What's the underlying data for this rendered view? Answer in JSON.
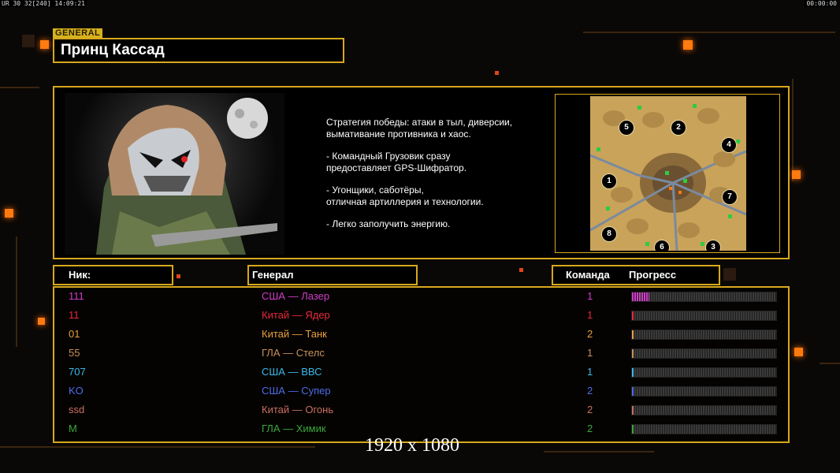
{
  "status_bar": {
    "left": "UR 30 32[240] 14:09:21",
    "right": "00:00:00"
  },
  "general_tag": "GENERAL",
  "general_name": "Принц Кассад",
  "strategy": [
    "Стратегия победы: атаки в тыл, диверсии,\n вымативание противника и хаос.",
    "- Командный Грузовик сразу\nпредоставляет GPS-Шифратор.",
    "- Угонщики, саботёры,\nотличная артиллерия и технологии.",
    "- Легко заполучить энергию."
  ],
  "map_spots": [
    "1",
    "2",
    "3",
    "4",
    "5",
    "6",
    "7",
    "8"
  ],
  "columns": {
    "nick": "Ник:",
    "general": "Генерал",
    "team": "Команда",
    "progress": "Прогресс"
  },
  "players": [
    {
      "nick": "111",
      "general": "США — Лазер",
      "team": "1",
      "color": "#d03cc8",
      "progress": 0.12
    },
    {
      "nick": "11",
      "general": "Китай — Ядер",
      "team": "1",
      "color": "#e8283a",
      "progress": 0.01
    },
    {
      "nick": "01",
      "general": "Китай — Танк",
      "team": "2",
      "color": "#e8a040",
      "progress": 0.01
    },
    {
      "nick": "55",
      "general": "ГЛА — Стелс",
      "team": "1",
      "color": "#c8905a",
      "progress": 0.01
    },
    {
      "nick": "707",
      "general": "США — ВВС",
      "team": "1",
      "color": "#3ab8e8",
      "progress": 0.01
    },
    {
      "nick": "KO",
      "general": "США — Супер",
      "team": "2",
      "color": "#4a6ee8",
      "progress": 0.01
    },
    {
      "nick": "ssd",
      "general": "Китай — Огонь",
      "team": "2",
      "color": "#c87060",
      "progress": 0.01
    },
    {
      "nick": "M",
      "general": "ГЛА — Химик",
      "team": "2",
      "color": "#3aa83a",
      "progress": 0.01
    }
  ],
  "resolution_label": "1920 x 1080"
}
